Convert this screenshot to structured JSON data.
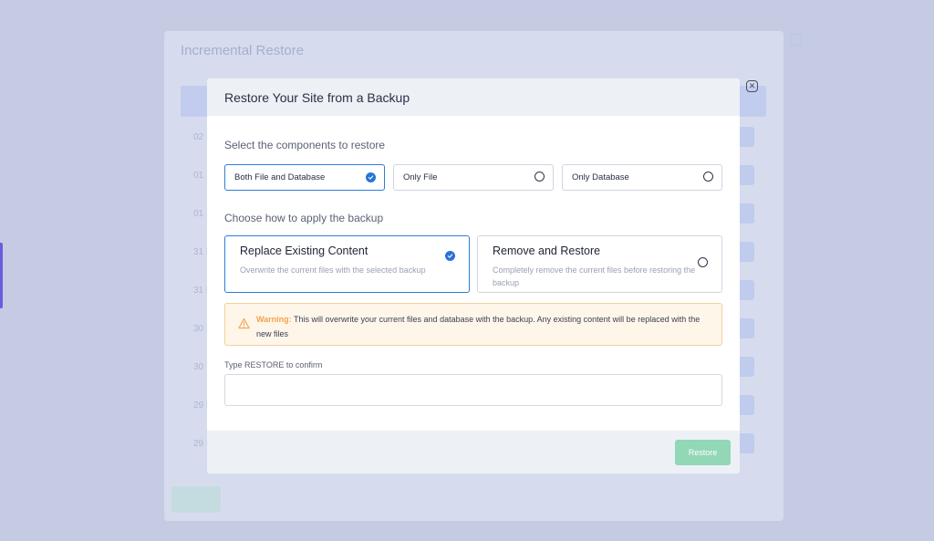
{
  "background": {
    "title": "Incremental Restore",
    "dates": [
      "02",
      "01",
      "01",
      "31 I",
      "31 I",
      "30",
      "30",
      "29 I",
      "29 I"
    ]
  },
  "modal": {
    "title": "Restore Your Site from a Backup",
    "close_icon": "close-icon",
    "components": {
      "label": "Select the components to restore",
      "options": [
        {
          "label": "Both File and Database",
          "selected": true
        },
        {
          "label": "Only File",
          "selected": false
        },
        {
          "label": "Only Database",
          "selected": false
        }
      ]
    },
    "apply": {
      "label": "Choose how to apply the backup",
      "options": [
        {
          "title": "Replace Existing Content",
          "desc": "Overwrite the current files with the selected backup",
          "selected": true
        },
        {
          "title": "Remove and Restore",
          "desc": "Completely remove the current files before restoring the backup",
          "selected": false
        }
      ]
    },
    "warning": {
      "icon": "warning-triangle-icon",
      "strong": "Warning:",
      "text": " This will overwrite your current files and database with the backup. Any existing content will be replaced with the new files"
    },
    "confirm": {
      "label": "Type RESTORE to confirm",
      "value": ""
    },
    "restore_button": "Restore"
  },
  "colors": {
    "accent": "#2a73d6",
    "restore_button": "#92d7b6",
    "warning": "#f1a34b",
    "overlay": "#c4cbe2"
  }
}
